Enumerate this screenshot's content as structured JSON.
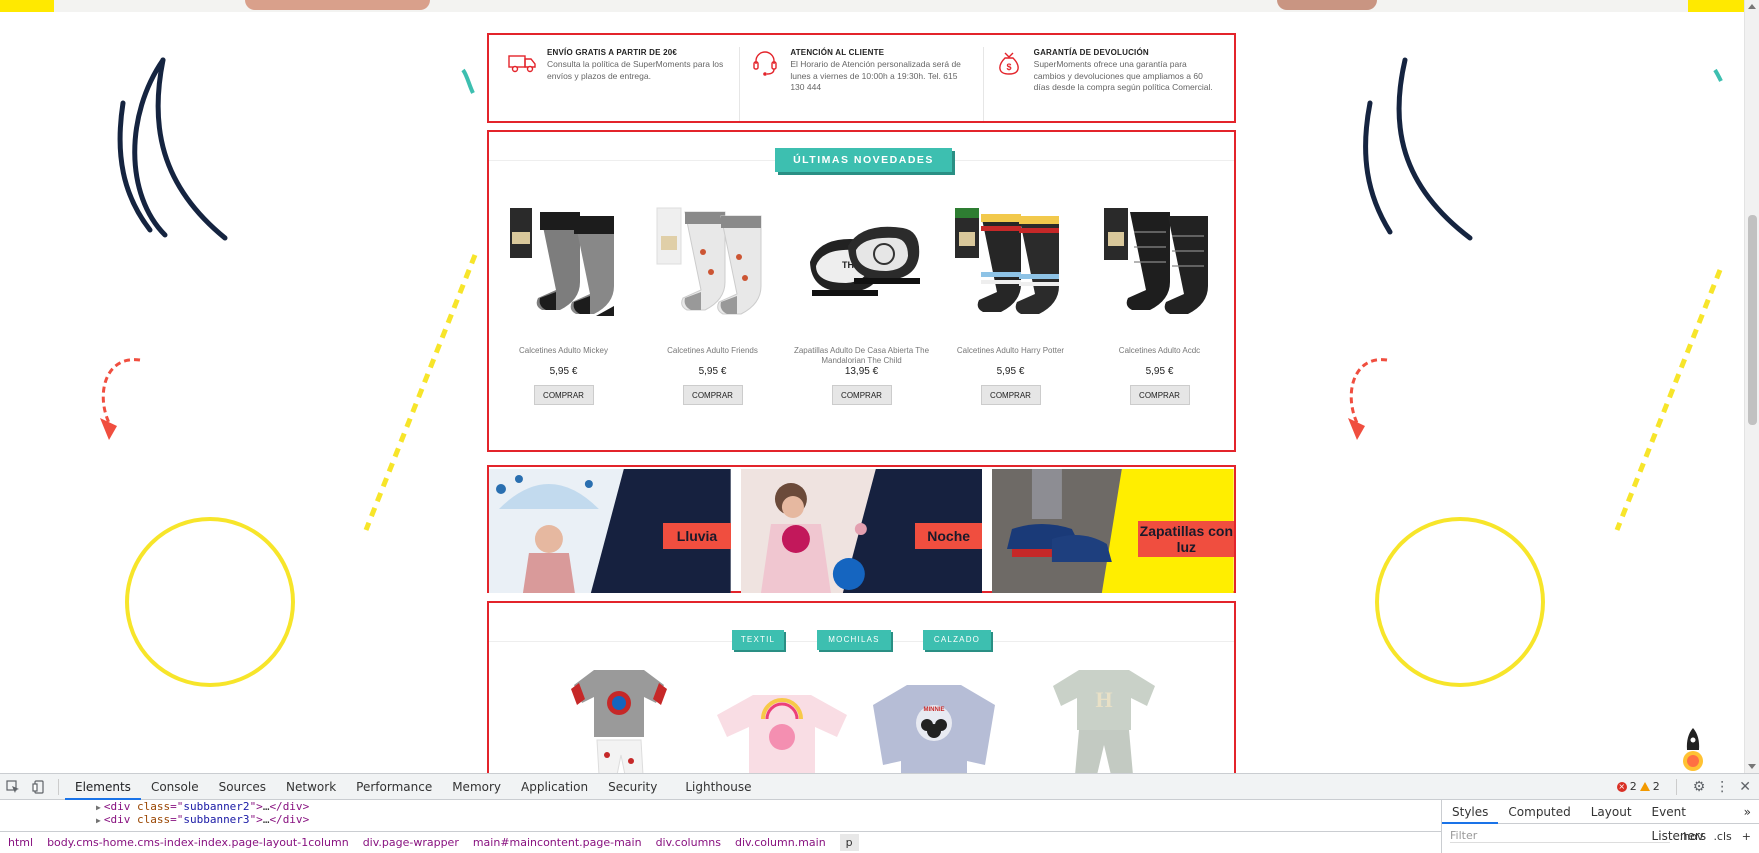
{
  "info": [
    {
      "title": "ENVÍO GRATIS A PARTIR DE 20€",
      "text": "Consulta la política de SuperMoments para los envíos y plazos de entrega.",
      "icon": "truck-icon"
    },
    {
      "title": "ATENCIÓN AL CLIENTE",
      "text": "El Horario de Atención personalizada será de lunes a viernes de 10:00h a 19:30h. Tel. 615 130 444",
      "icon": "headset-icon"
    },
    {
      "title": "GARANTÍA DE DEVOLUCIÓN",
      "text": "SuperMoments ofrece una garantía para cambios y devoluciones que ampliamos a 60 días desde la compra según política Comercial.",
      "icon": "money-bag-icon"
    }
  ],
  "novedades": {
    "title": "ÚLTIMAS NOVEDADES",
    "products": [
      {
        "name": "Calcetines Adulto Mickey",
        "price": "5,95 €",
        "button": "COMPRAR"
      },
      {
        "name": "Calcetines Adulto Friends",
        "price": "5,95 €",
        "button": "COMPRAR"
      },
      {
        "name": "Zapatillas Adulto De Casa Abierta The Mandalorian The Child",
        "price": "13,95 €",
        "button": "COMPRAR"
      },
      {
        "name": "Calcetines Adulto Harry Potter",
        "price": "5,95 €",
        "button": "COMPRAR"
      },
      {
        "name": "Calcetines Adulto Acdc",
        "price": "5,95 €",
        "button": "COMPRAR"
      }
    ]
  },
  "banners": [
    {
      "label": "Lluvia",
      "bg": "#16213f"
    },
    {
      "label": "Noche",
      "bg": "#16213f"
    },
    {
      "label": "Zapatillas con luz",
      "bg": "#ffee00"
    }
  ],
  "tabs": [
    "TEXTIL",
    "MOCHILAS",
    "CALZADO"
  ],
  "colors": {
    "accent": "#3dbfb0",
    "border": "#e3242b",
    "navy": "#16213f",
    "yellow": "#f7e52a",
    "coral": "#f04e3f"
  },
  "devtools": {
    "tabs": [
      "Elements",
      "Console",
      "Sources",
      "Network",
      "Performance",
      "Memory",
      "Application",
      "Security",
      "Lighthouse"
    ],
    "active_tab": "Elements",
    "errors": "2",
    "warnings": "2",
    "code_lines": [
      {
        "tag": "div",
        "attr": "class",
        "value": "subbanner2"
      },
      {
        "tag": "div",
        "attr": "class",
        "value": "subbanner3"
      }
    ],
    "breadcrumbs": [
      "html",
      "body.cms-home.cms-index-index.page-layout-1column",
      "div.page-wrapper",
      "main#maincontent.page-main",
      "div.columns",
      "div.column.main",
      "p"
    ],
    "styles_tabs": [
      "Styles",
      "Computed",
      "Layout",
      "Event Listeners"
    ],
    "filter_placeholder": "Filter",
    "filter_opts": [
      ":hov",
      ".cls",
      "+"
    ]
  }
}
